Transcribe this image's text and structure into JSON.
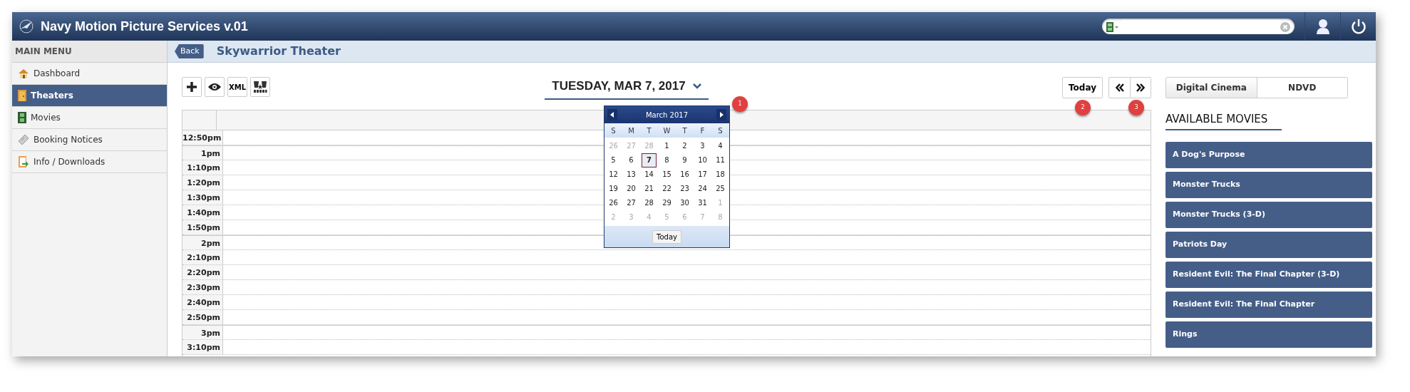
{
  "app": {
    "title": "Navy Motion Picture Services v.01"
  },
  "sidebar": {
    "heading": "MAIN MENU",
    "items": [
      {
        "label": "Dashboard",
        "kind": "home",
        "selected": false
      },
      {
        "label": "Theaters",
        "kind": "door",
        "selected": true
      },
      {
        "label": "Movies",
        "kind": "film",
        "selected": false
      },
      {
        "label": "Booking Notices",
        "kind": "ticket",
        "selected": false
      },
      {
        "label": "Info / Downloads",
        "kind": "book",
        "selected": false
      }
    ]
  },
  "page": {
    "back": "Back",
    "title": "Skywarrior Theater"
  },
  "toolbar": [
    {
      "kind": "add"
    },
    {
      "kind": "view"
    },
    {
      "kind": "text",
      "label": "XML"
    },
    {
      "kind": "seats"
    }
  ],
  "date_title": "TUESDAY, MAR 7, 2017",
  "today_button": "Today",
  "calendar": {
    "month": "March 2017",
    "weekdays": [
      "S",
      "M",
      "T",
      "W",
      "T",
      "F",
      "S"
    ],
    "today": "Today",
    "weeks": [
      [
        {
          "label": "26",
          "outside": true,
          "selected": false
        },
        {
          "label": "27",
          "outside": true,
          "selected": false
        },
        {
          "label": "28",
          "outside": true,
          "selected": false
        },
        {
          "label": "1",
          "outside": false,
          "selected": false
        },
        {
          "label": "2",
          "outside": false,
          "selected": false
        },
        {
          "label": "3",
          "outside": false,
          "selected": false
        },
        {
          "label": "4",
          "outside": false,
          "selected": false
        }
      ],
      [
        {
          "label": "5",
          "outside": false,
          "selected": false
        },
        {
          "label": "6",
          "outside": false,
          "selected": false
        },
        {
          "label": "7",
          "outside": false,
          "selected": true
        },
        {
          "label": "8",
          "outside": false,
          "selected": false
        },
        {
          "label": "9",
          "outside": false,
          "selected": false
        },
        {
          "label": "10",
          "outside": false,
          "selected": false
        },
        {
          "label": "11",
          "outside": false,
          "selected": false
        }
      ],
      [
        {
          "label": "12",
          "outside": false,
          "selected": false
        },
        {
          "label": "13",
          "outside": false,
          "selected": false
        },
        {
          "label": "14",
          "outside": false,
          "selected": false
        },
        {
          "label": "15",
          "outside": false,
          "selected": false
        },
        {
          "label": "16",
          "outside": false,
          "selected": false
        },
        {
          "label": "17",
          "outside": false,
          "selected": false
        },
        {
          "label": "18",
          "outside": false,
          "selected": false
        }
      ],
      [
        {
          "label": "19",
          "outside": false,
          "selected": false
        },
        {
          "label": "20",
          "outside": false,
          "selected": false
        },
        {
          "label": "21",
          "outside": false,
          "selected": false
        },
        {
          "label": "22",
          "outside": false,
          "selected": false
        },
        {
          "label": "23",
          "outside": false,
          "selected": false
        },
        {
          "label": "24",
          "outside": false,
          "selected": false
        },
        {
          "label": "25",
          "outside": false,
          "selected": false
        }
      ],
      [
        {
          "label": "26",
          "outside": false,
          "selected": false
        },
        {
          "label": "27",
          "outside": false,
          "selected": false
        },
        {
          "label": "28",
          "outside": false,
          "selected": false
        },
        {
          "label": "29",
          "outside": false,
          "selected": false
        },
        {
          "label": "30",
          "outside": false,
          "selected": false
        },
        {
          "label": "31",
          "outside": false,
          "selected": false
        },
        {
          "label": "1",
          "outside": true,
          "selected": false
        }
      ],
      [
        {
          "label": "2",
          "outside": true,
          "selected": false
        },
        {
          "label": "3",
          "outside": true,
          "selected": false
        },
        {
          "label": "4",
          "outside": true,
          "selected": false
        },
        {
          "label": "5",
          "outside": true,
          "selected": false
        },
        {
          "label": "6",
          "outside": true,
          "selected": false
        },
        {
          "label": "7",
          "outside": true,
          "selected": false
        },
        {
          "label": "8",
          "outside": true,
          "selected": false
        }
      ]
    ]
  },
  "callouts": [
    "1",
    "2",
    "3"
  ],
  "times": [
    "12:50pm",
    "1pm",
    "1:10pm",
    "1:20pm",
    "1:30pm",
    "1:40pm",
    "1:50pm",
    "2pm",
    "2:10pm",
    "2:20pm",
    "2:30pm",
    "2:40pm",
    "2:50pm",
    "3pm",
    "3:10pm"
  ],
  "format_tabs": [
    {
      "label": "Digital Cinema",
      "selected": true
    },
    {
      "label": "NDVD",
      "selected": false
    }
  ],
  "movies_heading": "AVAILABLE MOVIES",
  "movies": [
    "A Dog's Purpose",
    "Monster Trucks",
    "Monster Trucks (3-D)",
    "Patriots Day",
    "Resident Evil: The Final Chapter (3-D)",
    "Resident Evil: The Final Chapter",
    "Rings"
  ]
}
